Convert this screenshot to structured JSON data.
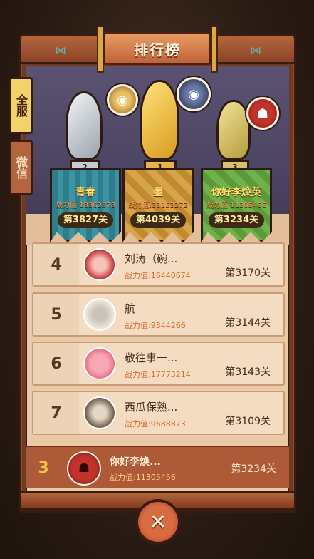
{
  "header": {
    "title": "排行榜"
  },
  "side_tabs": [
    {
      "label": "全服",
      "active": true
    },
    {
      "label": "微信",
      "active": false
    }
  ],
  "podium": [
    {
      "rank_label": "2",
      "name": "青春",
      "power": "战力值:18362378",
      "level": "第3827关",
      "trophy": "silver"
    },
    {
      "rank_label": "1",
      "name": "墨",
      "power": "战力值:33153272",
      "level": "第4039关",
      "trophy": "gold"
    },
    {
      "rank_label": "3",
      "name": "你好李焕英",
      "power": "战力值:11305456",
      "level": "第3234关",
      "trophy": "bronze"
    }
  ],
  "list": [
    {
      "rank": "4",
      "name": "刘涛（碗...",
      "power": "战力值:16440674",
      "level": "第3170关"
    },
    {
      "rank": "5",
      "name": "航",
      "power": "战力值:9344266",
      "level": "第3144关"
    },
    {
      "rank": "6",
      "name": "敬往事一...",
      "power": "战力值:17773214",
      "level": "第3143关"
    },
    {
      "rank": "7",
      "name": "西瓜保熟...",
      "power": "战力值:9688873",
      "level": "第3109关"
    }
  ],
  "me": {
    "rank": "3",
    "name": "你好李焕...",
    "power": "战力值:11305456",
    "level": "第3234关"
  },
  "close_label": "✕",
  "colors": {
    "accent": "#c0643a",
    "gold": "#ffe16b",
    "power": "#e0692c"
  }
}
